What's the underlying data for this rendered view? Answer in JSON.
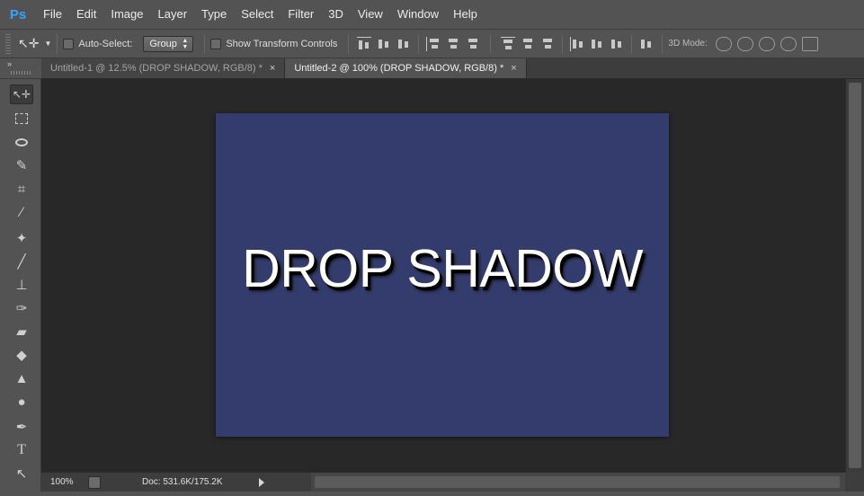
{
  "app": {
    "logo": "Ps",
    "accent": "#31a8ff"
  },
  "menu": [
    "File",
    "Edit",
    "Image",
    "Layer",
    "Type",
    "Select",
    "Filter",
    "3D",
    "View",
    "Window",
    "Help"
  ],
  "options": {
    "auto_select_label": "Auto-Select:",
    "auto_select_checked": false,
    "auto_select_value": "Group",
    "show_transform_label": "Show Transform Controls",
    "show_transform_checked": false,
    "mode3d_label": "3D Mode:"
  },
  "tabs": [
    {
      "label": "Untitled-1 @ 12.5% (DROP SHADOW, RGB/8) *",
      "active": false
    },
    {
      "label": "Untitled-2 @ 100% (DROP SHADOW, RGB/8) *",
      "active": true
    }
  ],
  "tools": [
    "move-tool",
    "marquee-tool",
    "lasso-tool",
    "quick-selection-tool",
    "crop-tool",
    "eyedropper-tool",
    "healing-brush-tool",
    "brush-tool",
    "clone-stamp-tool",
    "history-brush-tool",
    "eraser-tool",
    "paint-bucket-tool",
    "blur-tool",
    "dodge-tool",
    "pen-tool",
    "type-tool",
    "path-selection-tool"
  ],
  "canvas": {
    "text": "DROP SHADOW",
    "background_color": "#333c6c",
    "text_color": "#ffffff"
  },
  "status": {
    "zoom": "100%",
    "doc_info": "Doc: 531.6K/175.2K"
  }
}
